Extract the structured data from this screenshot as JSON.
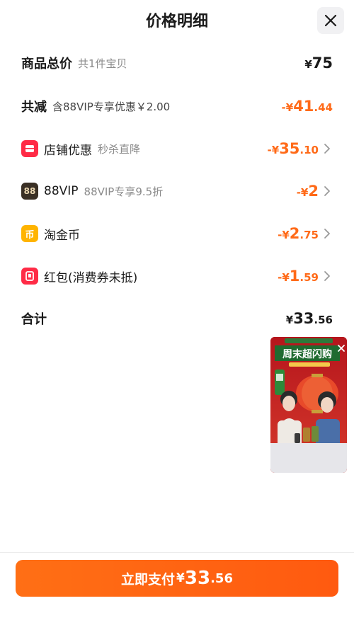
{
  "header": {
    "title": "价格明细"
  },
  "rows": {
    "subtotal": {
      "label": "商品总价",
      "sub": "共1件宝贝",
      "currency": "¥",
      "int": "75",
      "dec": ""
    },
    "discount_total": {
      "label": "共减",
      "sub": "含88VIP专享优惠￥2.00",
      "currency": "-¥",
      "int": "41",
      "dec": ".44"
    },
    "shop": {
      "label": "店铺优惠",
      "sub": "秒杀直降",
      "currency": "-¥",
      "int": "35",
      "dec": ".10"
    },
    "vip": {
      "label": "88VIP",
      "sub": "88VIP专享9.5折",
      "icon_text": "88",
      "currency": "-¥",
      "int": "2",
      "dec": ""
    },
    "coin": {
      "label": "淘金币",
      "icon_text": "币",
      "currency": "-¥",
      "int": "2",
      "dec": ".75"
    },
    "redpacket": {
      "label": "红包(消费券未抵)",
      "currency": "-¥",
      "int": "1",
      "dec": ".59"
    },
    "total": {
      "label": "合计",
      "currency": "¥",
      "int": "33",
      "dec": ".56"
    }
  },
  "live": {
    "banner": "周末超闪购"
  },
  "footer": {
    "pay_label": "立即支付",
    "currency": "¥",
    "int": "33",
    "dec": ".56"
  },
  "colors": {
    "accent": "#ff6a18",
    "button": "#ff5f12",
    "red_icon": "#ff2b46",
    "coin_icon": "#ffb400",
    "vip_icon": "#3a3025"
  }
}
